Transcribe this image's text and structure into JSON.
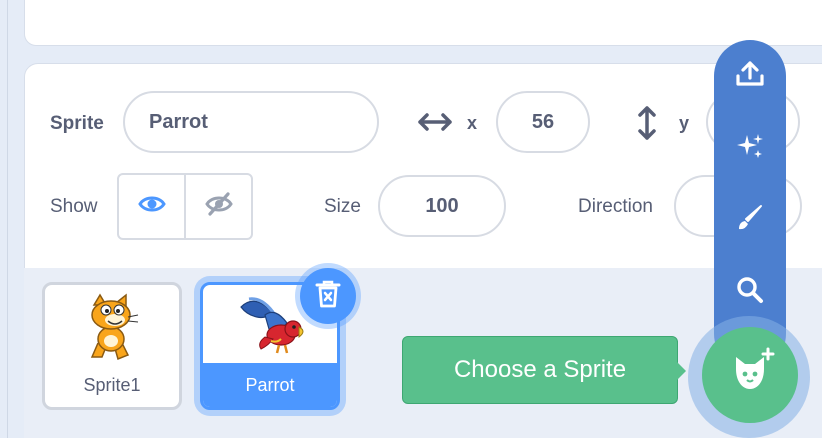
{
  "sprite_info": {
    "sprite_label": "Sprite",
    "sprite_name": "Parrot",
    "x_label": "x",
    "x_value": "56",
    "y_label": "y",
    "y_value": "",
    "show_label": "Show",
    "size_label": "Size",
    "size_value": "100",
    "direction_label": "Direction",
    "direction_value": ""
  },
  "sprites": [
    {
      "name": "Sprite1",
      "selected": false
    },
    {
      "name": "Parrot",
      "selected": true
    }
  ],
  "sprite_menu": {
    "items": [
      "upload-sprite-icon",
      "surprise-icon",
      "paint-icon",
      "search-icon"
    ],
    "tooltip": "Choose a Sprite",
    "accent": "#4c97ff",
    "menu_color": "#4c7fcf",
    "choose_color": "#59c08c"
  },
  "colors": {
    "selected": "#4c97ff",
    "text": "#575e75",
    "panel_bg": "#e9eef7"
  }
}
